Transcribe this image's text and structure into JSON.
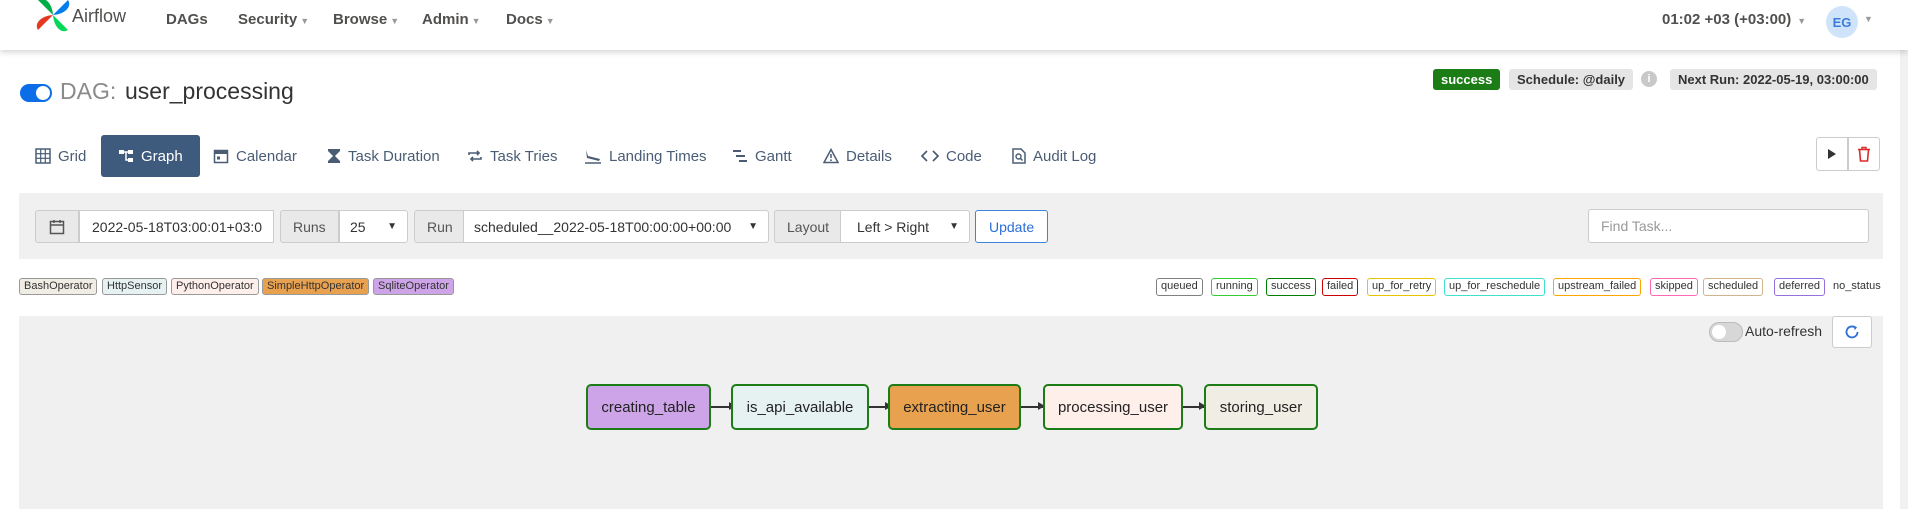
{
  "navbar": {
    "brand": "Airflow",
    "items": [
      {
        "label": "DAGs",
        "has_caret": false
      },
      {
        "label": "Security",
        "has_caret": true
      },
      {
        "label": "Browse",
        "has_caret": true
      },
      {
        "label": "Admin",
        "has_caret": true
      },
      {
        "label": "Docs",
        "has_caret": true
      }
    ],
    "clock": "01:02 +03 (+03:00)",
    "user_initials": "EG"
  },
  "dag": {
    "label": "DAG:",
    "id": "user_processing",
    "paused": false,
    "status": "success",
    "schedule": "Schedule: @daily",
    "next_run": "Next Run: 2022-05-19, 03:00:00"
  },
  "tabs": [
    {
      "label": "Grid",
      "icon": "grid-icon",
      "active": false
    },
    {
      "label": "Graph",
      "icon": "graph-icon",
      "active": true
    },
    {
      "label": "Calendar",
      "icon": "calendar-icon",
      "active": false
    },
    {
      "label": "Task Duration",
      "icon": "hourglass-icon",
      "active": false
    },
    {
      "label": "Task Tries",
      "icon": "repeat-icon",
      "active": false
    },
    {
      "label": "Landing Times",
      "icon": "plane-landing-icon",
      "active": false
    },
    {
      "label": "Gantt",
      "icon": "gantt-icon",
      "active": false
    },
    {
      "label": "Details",
      "icon": "warning-triangle-icon",
      "active": false
    },
    {
      "label": "Code",
      "icon": "code-icon",
      "active": false
    },
    {
      "label": "Audit Log",
      "icon": "search-file-icon",
      "active": false
    }
  ],
  "controls": {
    "date_value": "2022-05-18T03:00:01+03:0",
    "runs_label": "Runs",
    "runs_value": "25",
    "run_label": "Run",
    "run_value": "scheduled__2022-05-18T00:00:00+00:00",
    "layout_label": "Layout",
    "layout_value": "Left > Right",
    "update_label": "Update",
    "find_task_placeholder": "Find Task..."
  },
  "operator_legend": [
    {
      "label": "BashOperator",
      "color": "#f0ede4"
    },
    {
      "label": "HttpSensor",
      "color": "#e6f1f2"
    },
    {
      "label": "PythonOperator",
      "color": "#ffefeb"
    },
    {
      "label": "SimpleHttpOperator",
      "color": "#e8a14f"
    },
    {
      "label": "SqliteOperator",
      "color": "#cda4e8"
    }
  ],
  "state_legend": [
    {
      "label": "queued",
      "color": "#808080"
    },
    {
      "label": "running",
      "color": "#32cd32"
    },
    {
      "label": "success",
      "color": "#008000"
    },
    {
      "label": "failed",
      "color": "#cc0000"
    },
    {
      "label": "up_for_retry",
      "color": "#e8c400"
    },
    {
      "label": "up_for_reschedule",
      "color": "#40e0d0"
    },
    {
      "label": "upstream_failed",
      "color": "#ffa500"
    },
    {
      "label": "skipped",
      "color": "#ff69b4"
    },
    {
      "label": "scheduled",
      "color": "#d2b48c"
    },
    {
      "label": "deferred",
      "color": "#9370db"
    },
    {
      "label": "no_status",
      "color": ""
    }
  ],
  "graph": {
    "auto_refresh_label": "Auto-refresh",
    "auto_refresh_on": false,
    "tasks": [
      {
        "id": "creating_table",
        "fill": "#cda4e8"
      },
      {
        "id": "is_api_available",
        "fill": "#e6f1f2"
      },
      {
        "id": "extracting_user",
        "fill": "#e8a14f"
      },
      {
        "id": "processing_user",
        "fill": "#ffefeb"
      },
      {
        "id": "storing_user",
        "fill": "#f0ede4"
      }
    ],
    "task_state": "success",
    "state_border_color": "#1c7c15"
  }
}
